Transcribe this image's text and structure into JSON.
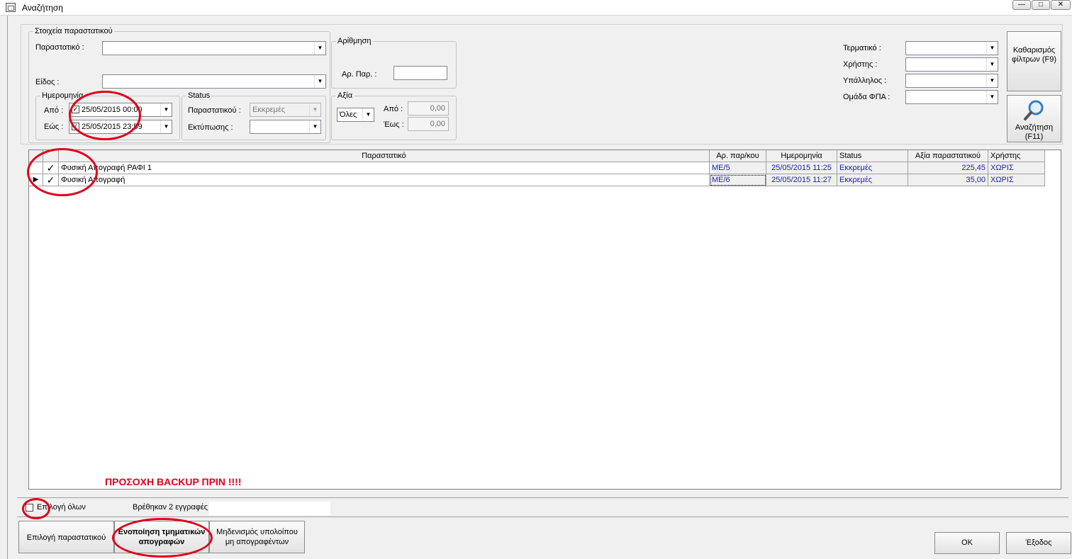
{
  "window": {
    "title": "Αναζήτηση",
    "min": "—",
    "max": "□",
    "close": "✕"
  },
  "filters": {
    "doc_group_legend": "Στοιχεία παραστατικού",
    "document_label": "Παραστατικό :",
    "document_value": "",
    "kind_label": "Είδος :",
    "kind_value": "",
    "date_legend": "Ημερομηνία",
    "from_label": "Από :",
    "from_value": "25/05/2015 00:00",
    "to_label": "Εώς :",
    "to_value": "25/05/2015 23:59",
    "numbering_legend": "Αρίθμηση",
    "doc_no_label": "Αρ. Παρ. :",
    "doc_no_value": "",
    "status_legend": "Status",
    "status_doc_label": "Παραστατικού :",
    "status_doc_value": "Εκκρεμές",
    "status_print_label": "Εκτύπωσης :",
    "status_print_value": "",
    "value_legend": "Αξία",
    "value_mode": "Όλες",
    "value_from_label": "Από :",
    "value_from": "0,00",
    "value_to_label": "Έως :",
    "value_to": "0,00",
    "terminal_label": "Τερματικό :",
    "user_label": "Χρήστης :",
    "employee_label": "Υπάλληλος :",
    "vat_group_label": "Ομάδα ΦΠΑ :"
  },
  "buttons": {
    "clear_filters": "Καθαρισμός φίλτρων (F9)",
    "search": "Αναζήτηση (F11)",
    "select_document": "Επιλογή παραστατικού",
    "merge_inventories": "Ενοποίηση τμηματικών απογραφών",
    "zero_balance": "Μηδενισμός υπολοίπου μη απογραφέντων",
    "ok": "OK",
    "exit": "Έξοδος"
  },
  "grid": {
    "columns": [
      "Παραστατικό",
      "Αρ. παρ/κου",
      "Ημερομηνία",
      "Status",
      "Αξία παραστατικού",
      "Χρήστης"
    ],
    "rows": [
      {
        "doc": "Φυσική Απογραφή ΡΑΦΙ 1",
        "no": "ΜΕ/5",
        "date": "25/05/2015 11:25",
        "status": "Εκκρεμές",
        "value": "225,45",
        "user": "ΧΩΡΙΣ",
        "checked": "✓"
      },
      {
        "doc": "Φυσική Απογραφή",
        "no": "ΜΕ/6",
        "date": "25/05/2015 11:27",
        "status": "Εκκρεμές",
        "value": "35,00",
        "user": "ΧΩΡΙΣ",
        "checked": "✓"
      }
    ]
  },
  "warning": "ΠΡΟΣΟΧΗ BACKUP ΠΡΙΝ !!!!",
  "footer": {
    "select_all": "Επιλογή όλων",
    "found": "Βρέθηκαν 2 εγγραφές"
  },
  "colors": {
    "annotation": "#e0001a",
    "link_blue": "#2020c0"
  }
}
